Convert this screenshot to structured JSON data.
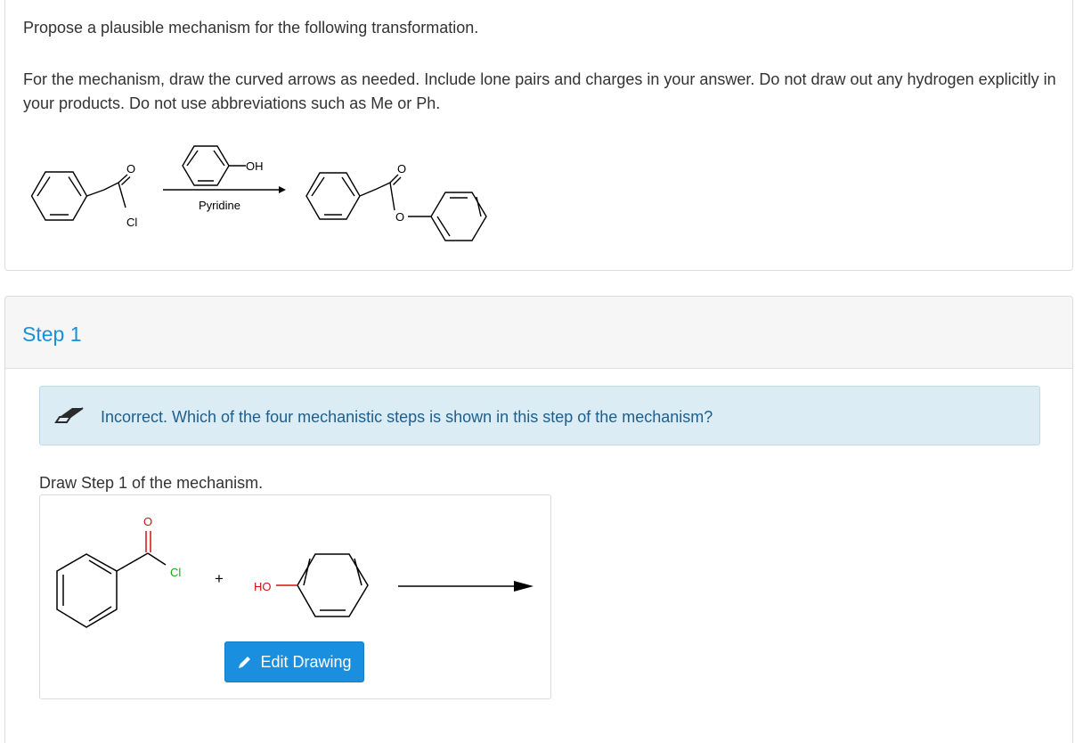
{
  "question": {
    "prompt": "Propose a plausible mechanism for the following transformation.",
    "instructions": "For the mechanism, draw the curved arrows as needed. Include lone pairs and charges in your answer. Do not draw out any hydrogen explicitly in your products. Do not use abbreviations such as Me or Ph."
  },
  "scheme": {
    "reactant_o": "O",
    "reactant_cl": "Cl",
    "reagent_oh": "OH",
    "reagent_condition": "Pyridine",
    "product_carbonyl_o": "O",
    "product_ester_o": "O"
  },
  "step": {
    "title": "Step 1",
    "feedback": "Incorrect. Which of the four mechanistic steps is shown in this step of the mechanism?",
    "draw_label": "Draw Step 1 of the mechanism.",
    "drawing": {
      "carbonyl_o": "O",
      "cl": "Cl",
      "plus": "+",
      "ho": "HO"
    },
    "edit_button_label": "Edit Drawing"
  },
  "icons": {
    "feedback": "eraser-icon",
    "edit": "pencil-icon"
  },
  "colors": {
    "step_title": "#1a8fd6",
    "feedback_bg": "#dbecf5",
    "feedback_text": "#1f5e8a",
    "button_bg": "#1a8fe0",
    "chlorine": "#1aa51a",
    "oxygen": "#d01010"
  }
}
